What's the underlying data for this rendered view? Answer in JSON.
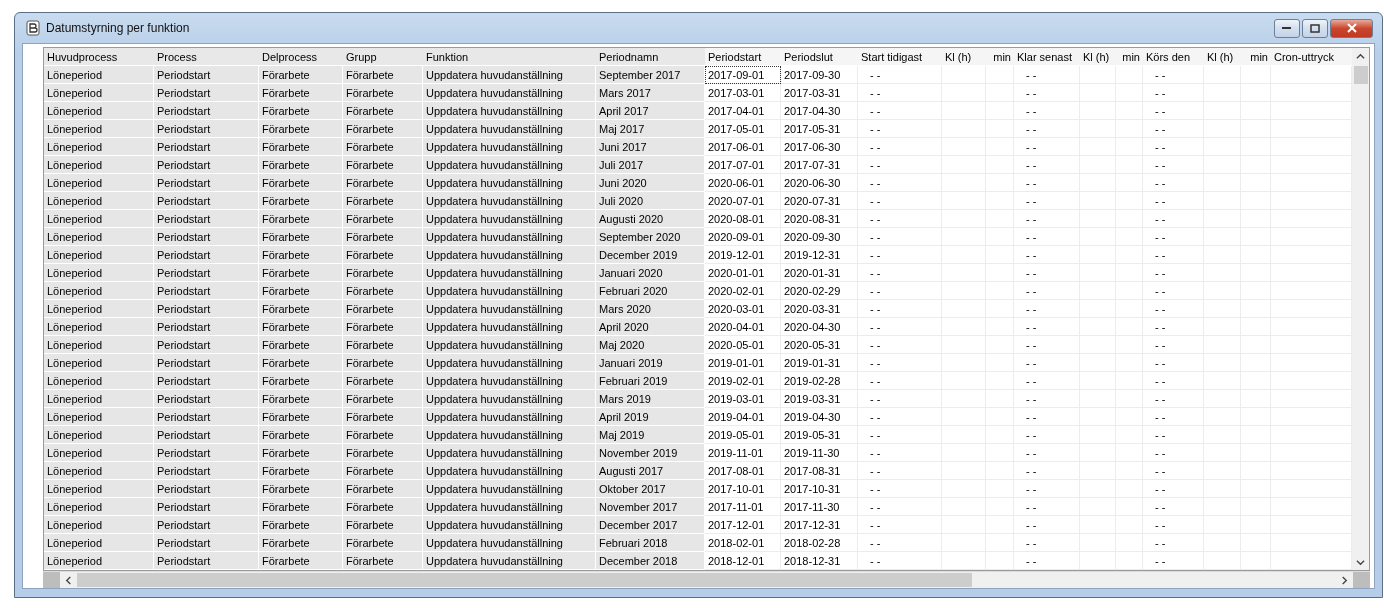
{
  "window": {
    "title": "Datumstyrning per funktion"
  },
  "table": {
    "columns": [
      {
        "label": "Huvudprocess",
        "shaded": true
      },
      {
        "label": "Process",
        "shaded": true
      },
      {
        "label": "Delprocess",
        "shaded": true
      },
      {
        "label": "Grupp",
        "shaded": true
      },
      {
        "label": "Funktion",
        "shaded": true
      },
      {
        "label": "Periodnamn",
        "shaded": true
      },
      {
        "label": "Periodstart",
        "shaded": false
      },
      {
        "label": "Periodslut",
        "shaded": false
      },
      {
        "label": "Start tidigast",
        "shaded": false
      },
      {
        "label": "Kl (h)",
        "shaded": false
      },
      {
        "label": "min",
        "shaded": false
      },
      {
        "label": "Klar senast",
        "shaded": false
      },
      {
        "label": "Kl (h)",
        "shaded": false
      },
      {
        "label": "min",
        "shaded": false
      },
      {
        "label": "Körs den",
        "shaded": false
      },
      {
        "label": "Kl (h)",
        "shaded": false
      },
      {
        "label": "min",
        "shaded": false
      },
      {
        "label": "Cron-uttryck",
        "shaded": false
      }
    ],
    "rows": [
      {
        "huvudprocess": "Löneperiod",
        "process": "Periodstart",
        "delprocess": "Förarbete",
        "grupp": "Förarbete",
        "funktion": "Uppdatera huvudanställning",
        "periodnamn": "September 2017",
        "periodstart": "2017-09-01",
        "periodslut": "2017-09-30",
        "start_tidigast": "- -",
        "klar_senast": "- -",
        "kors_den": "- -",
        "focused": true
      },
      {
        "huvudprocess": "Löneperiod",
        "process": "Periodstart",
        "delprocess": "Förarbete",
        "grupp": "Förarbete",
        "funktion": "Uppdatera huvudanställning",
        "periodnamn": "Mars 2017",
        "periodstart": "2017-03-01",
        "periodslut": "2017-03-31",
        "start_tidigast": "- -",
        "klar_senast": "- -",
        "kors_den": "- -",
        "focused": false
      },
      {
        "huvudprocess": "Löneperiod",
        "process": "Periodstart",
        "delprocess": "Förarbete",
        "grupp": "Förarbete",
        "funktion": "Uppdatera huvudanställning",
        "periodnamn": "April 2017",
        "periodstart": "2017-04-01",
        "periodslut": "2017-04-30",
        "start_tidigast": "- -",
        "klar_senast": "- -",
        "kors_den": "- -",
        "focused": false
      },
      {
        "huvudprocess": "Löneperiod",
        "process": "Periodstart",
        "delprocess": "Förarbete",
        "grupp": "Förarbete",
        "funktion": "Uppdatera huvudanställning",
        "periodnamn": "Maj 2017",
        "periodstart": "2017-05-01",
        "periodslut": "2017-05-31",
        "start_tidigast": "- -",
        "klar_senast": "- -",
        "kors_den": "- -",
        "focused": false
      },
      {
        "huvudprocess": "Löneperiod",
        "process": "Periodstart",
        "delprocess": "Förarbete",
        "grupp": "Förarbete",
        "funktion": "Uppdatera huvudanställning",
        "periodnamn": "Juni 2017",
        "periodstart": "2017-06-01",
        "periodslut": "2017-06-30",
        "start_tidigast": "- -",
        "klar_senast": "- -",
        "kors_den": "- -",
        "focused": false
      },
      {
        "huvudprocess": "Löneperiod",
        "process": "Periodstart",
        "delprocess": "Förarbete",
        "grupp": "Förarbete",
        "funktion": "Uppdatera huvudanställning",
        "periodnamn": "Juli 2017",
        "periodstart": "2017-07-01",
        "periodslut": "2017-07-31",
        "start_tidigast": "- -",
        "klar_senast": "- -",
        "kors_den": "- -",
        "focused": false
      },
      {
        "huvudprocess": "Löneperiod",
        "process": "Periodstart",
        "delprocess": "Förarbete",
        "grupp": "Förarbete",
        "funktion": "Uppdatera huvudanställning",
        "periodnamn": "Juni 2020",
        "periodstart": "2020-06-01",
        "periodslut": "2020-06-30",
        "start_tidigast": "- -",
        "klar_senast": "- -",
        "kors_den": "- -",
        "focused": false
      },
      {
        "huvudprocess": "Löneperiod",
        "process": "Periodstart",
        "delprocess": "Förarbete",
        "grupp": "Förarbete",
        "funktion": "Uppdatera huvudanställning",
        "periodnamn": "Juli 2020",
        "periodstart": "2020-07-01",
        "periodslut": "2020-07-31",
        "start_tidigast": "- -",
        "klar_senast": "- -",
        "kors_den": "- -",
        "focused": false
      },
      {
        "huvudprocess": "Löneperiod",
        "process": "Periodstart",
        "delprocess": "Förarbete",
        "grupp": "Förarbete",
        "funktion": "Uppdatera huvudanställning",
        "periodnamn": "Augusti 2020",
        "periodstart": "2020-08-01",
        "periodslut": "2020-08-31",
        "start_tidigast": "- -",
        "klar_senast": "- -",
        "kors_den": "- -",
        "focused": false
      },
      {
        "huvudprocess": "Löneperiod",
        "process": "Periodstart",
        "delprocess": "Förarbete",
        "grupp": "Förarbete",
        "funktion": "Uppdatera huvudanställning",
        "periodnamn": "September 2020",
        "periodstart": "2020-09-01",
        "periodslut": "2020-09-30",
        "start_tidigast": "- -",
        "klar_senast": "- -",
        "kors_den": "- -",
        "focused": false
      },
      {
        "huvudprocess": "Löneperiod",
        "process": "Periodstart",
        "delprocess": "Förarbete",
        "grupp": "Förarbete",
        "funktion": "Uppdatera huvudanställning",
        "periodnamn": "December 2019",
        "periodstart": "2019-12-01",
        "periodslut": "2019-12-31",
        "start_tidigast": "- -",
        "klar_senast": "- -",
        "kors_den": "- -",
        "focused": false
      },
      {
        "huvudprocess": "Löneperiod",
        "process": "Periodstart",
        "delprocess": "Förarbete",
        "grupp": "Förarbete",
        "funktion": "Uppdatera huvudanställning",
        "periodnamn": "Januari 2020",
        "periodstart": "2020-01-01",
        "periodslut": "2020-01-31",
        "start_tidigast": "- -",
        "klar_senast": "- -",
        "kors_den": "- -",
        "focused": false
      },
      {
        "huvudprocess": "Löneperiod",
        "process": "Periodstart",
        "delprocess": "Förarbete",
        "grupp": "Förarbete",
        "funktion": "Uppdatera huvudanställning",
        "periodnamn": "Februari 2020",
        "periodstart": "2020-02-01",
        "periodslut": "2020-02-29",
        "start_tidigast": "- -",
        "klar_senast": "- -",
        "kors_den": "- -",
        "focused": false
      },
      {
        "huvudprocess": "Löneperiod",
        "process": "Periodstart",
        "delprocess": "Förarbete",
        "grupp": "Förarbete",
        "funktion": "Uppdatera huvudanställning",
        "periodnamn": "Mars 2020",
        "periodstart": "2020-03-01",
        "periodslut": "2020-03-31",
        "start_tidigast": "- -",
        "klar_senast": "- -",
        "kors_den": "- -",
        "focused": false
      },
      {
        "huvudprocess": "Löneperiod",
        "process": "Periodstart",
        "delprocess": "Förarbete",
        "grupp": "Förarbete",
        "funktion": "Uppdatera huvudanställning",
        "periodnamn": "April 2020",
        "periodstart": "2020-04-01",
        "periodslut": "2020-04-30",
        "start_tidigast": "- -",
        "klar_senast": "- -",
        "kors_den": "- -",
        "focused": false
      },
      {
        "huvudprocess": "Löneperiod",
        "process": "Periodstart",
        "delprocess": "Förarbete",
        "grupp": "Förarbete",
        "funktion": "Uppdatera huvudanställning",
        "periodnamn": "Maj 2020",
        "periodstart": "2020-05-01",
        "periodslut": "2020-05-31",
        "start_tidigast": "- -",
        "klar_senast": "- -",
        "kors_den": "- -",
        "focused": false
      },
      {
        "huvudprocess": "Löneperiod",
        "process": "Periodstart",
        "delprocess": "Förarbete",
        "grupp": "Förarbete",
        "funktion": "Uppdatera huvudanställning",
        "periodnamn": "Januari 2019",
        "periodstart": "2019-01-01",
        "periodslut": "2019-01-31",
        "start_tidigast": "- -",
        "klar_senast": "- -",
        "kors_den": "- -",
        "focused": false
      },
      {
        "huvudprocess": "Löneperiod",
        "process": "Periodstart",
        "delprocess": "Förarbete",
        "grupp": "Förarbete",
        "funktion": "Uppdatera huvudanställning",
        "periodnamn": "Februari 2019",
        "periodstart": "2019-02-01",
        "periodslut": "2019-02-28",
        "start_tidigast": "- -",
        "klar_senast": "- -",
        "kors_den": "- -",
        "focused": false
      },
      {
        "huvudprocess": "Löneperiod",
        "process": "Periodstart",
        "delprocess": "Förarbete",
        "grupp": "Förarbete",
        "funktion": "Uppdatera huvudanställning",
        "periodnamn": "Mars 2019",
        "periodstart": "2019-03-01",
        "periodslut": "2019-03-31",
        "start_tidigast": "- -",
        "klar_senast": "- -",
        "kors_den": "- -",
        "focused": false
      },
      {
        "huvudprocess": "Löneperiod",
        "process": "Periodstart",
        "delprocess": "Förarbete",
        "grupp": "Förarbete",
        "funktion": "Uppdatera huvudanställning",
        "periodnamn": "April 2019",
        "periodstart": "2019-04-01",
        "periodslut": "2019-04-30",
        "start_tidigast": "- -",
        "klar_senast": "- -",
        "kors_den": "- -",
        "focused": false
      },
      {
        "huvudprocess": "Löneperiod",
        "process": "Periodstart",
        "delprocess": "Förarbete",
        "grupp": "Förarbete",
        "funktion": "Uppdatera huvudanställning",
        "periodnamn": "Maj 2019",
        "periodstart": "2019-05-01",
        "periodslut": "2019-05-31",
        "start_tidigast": "- -",
        "klar_senast": "- -",
        "kors_den": "- -",
        "focused": false
      },
      {
        "huvudprocess": "Löneperiod",
        "process": "Periodstart",
        "delprocess": "Förarbete",
        "grupp": "Förarbete",
        "funktion": "Uppdatera huvudanställning",
        "periodnamn": "November 2019",
        "periodstart": "2019-11-01",
        "periodslut": "2019-11-30",
        "start_tidigast": "- -",
        "klar_senast": "- -",
        "kors_den": "- -",
        "focused": false
      },
      {
        "huvudprocess": "Löneperiod",
        "process": "Periodstart",
        "delprocess": "Förarbete",
        "grupp": "Förarbete",
        "funktion": "Uppdatera huvudanställning",
        "periodnamn": "Augusti 2017",
        "periodstart": "2017-08-01",
        "periodslut": "2017-08-31",
        "start_tidigast": "- -",
        "klar_senast": "- -",
        "kors_den": "- -",
        "focused": false
      },
      {
        "huvudprocess": "Löneperiod",
        "process": "Periodstart",
        "delprocess": "Förarbete",
        "grupp": "Förarbete",
        "funktion": "Uppdatera huvudanställning",
        "periodnamn": "Oktober 2017",
        "periodstart": "2017-10-01",
        "periodslut": "2017-10-31",
        "start_tidigast": "- -",
        "klar_senast": "- -",
        "kors_den": "- -",
        "focused": false
      },
      {
        "huvudprocess": "Löneperiod",
        "process": "Periodstart",
        "delprocess": "Förarbete",
        "grupp": "Förarbete",
        "funktion": "Uppdatera huvudanställning",
        "periodnamn": "November 2017",
        "periodstart": "2017-11-01",
        "periodslut": "2017-11-30",
        "start_tidigast": "- -",
        "klar_senast": "- -",
        "kors_den": "- -",
        "focused": false
      },
      {
        "huvudprocess": "Löneperiod",
        "process": "Periodstart",
        "delprocess": "Förarbete",
        "grupp": "Förarbete",
        "funktion": "Uppdatera huvudanställning",
        "periodnamn": "December 2017",
        "periodstart": "2017-12-01",
        "periodslut": "2017-12-31",
        "start_tidigast": "- -",
        "klar_senast": "- -",
        "kors_den": "- -",
        "focused": false
      },
      {
        "huvudprocess": "Löneperiod",
        "process": "Periodstart",
        "delprocess": "Förarbete",
        "grupp": "Förarbete",
        "funktion": "Uppdatera huvudanställning",
        "periodnamn": "Februari 2018",
        "periodstart": "2018-02-01",
        "periodslut": "2018-02-28",
        "start_tidigast": "- -",
        "klar_senast": "- -",
        "kors_den": "- -",
        "focused": false
      },
      {
        "huvudprocess": "Löneperiod",
        "process": "Periodstart",
        "delprocess": "Förarbete",
        "grupp": "Förarbete",
        "funktion": "Uppdatera huvudanställning",
        "periodnamn": "December 2018",
        "periodstart": "2018-12-01",
        "periodslut": "2018-12-31",
        "start_tidigast": "- -",
        "klar_senast": "- -",
        "kors_den": "- -",
        "focused": false
      }
    ]
  }
}
